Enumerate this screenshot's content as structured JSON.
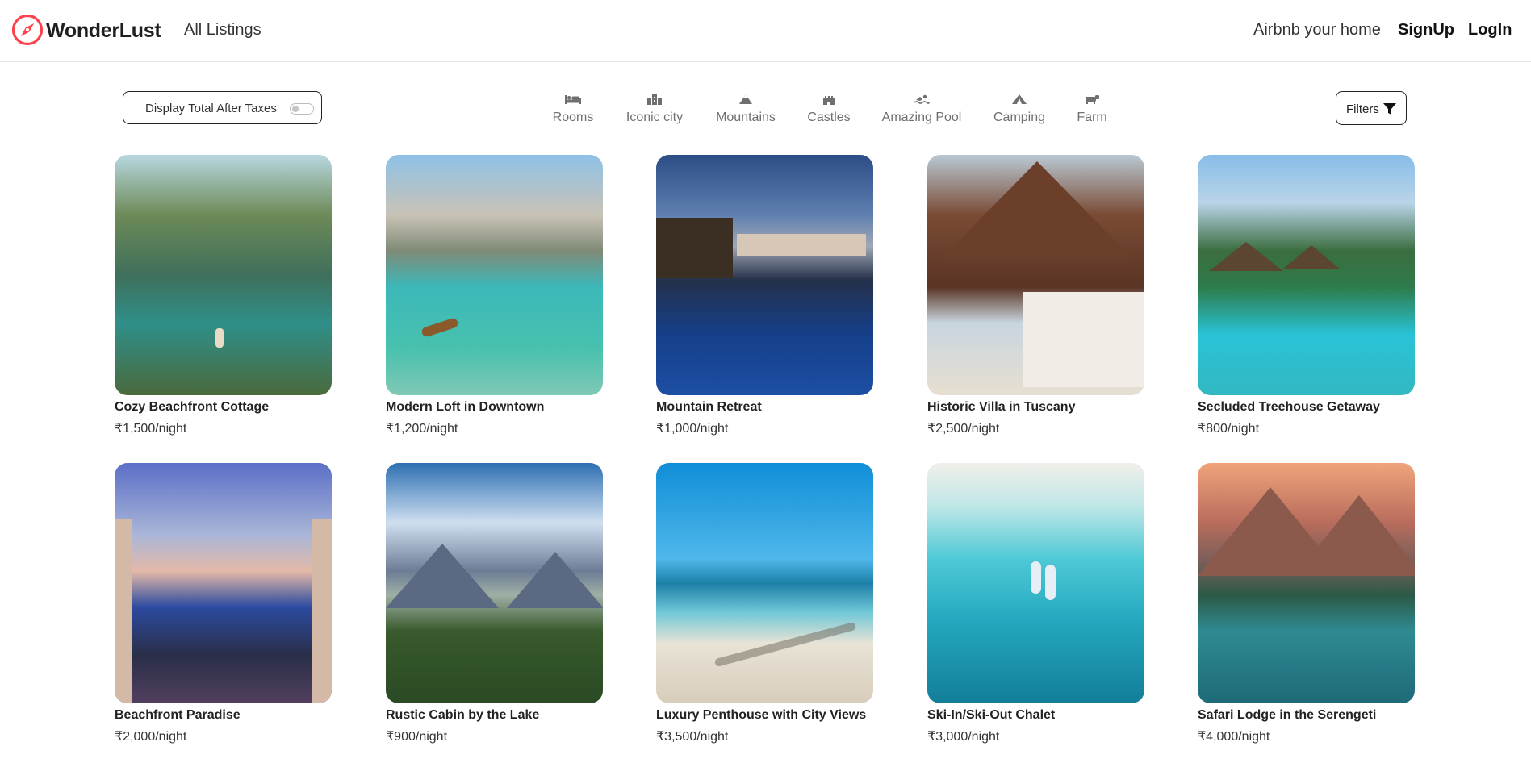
{
  "nav": {
    "brand": "WonderLust",
    "all_listings": "All Listings",
    "host_link": "Airbnb your home",
    "signup": "SignUp",
    "login": "LogIn"
  },
  "tax_toggle": {
    "label": "Display Total After Taxes",
    "enabled": false
  },
  "filters": [
    {
      "label": "Rooms",
      "icon": "bed-icon"
    },
    {
      "label": "Iconic city",
      "icon": "city-icon"
    },
    {
      "label": "Mountains",
      "icon": "mountain-icon"
    },
    {
      "label": "Castles",
      "icon": "castle-icon"
    },
    {
      "label": "Amazing Pool",
      "icon": "swimmer-icon"
    },
    {
      "label": "Camping",
      "icon": "tent-icon"
    },
    {
      "label": "Farm",
      "icon": "cow-icon"
    }
  ],
  "filters_button": {
    "label": "Filters",
    "icon": "funnel-icon"
  },
  "listings": [
    {
      "title": "Cozy Beachfront Cottage",
      "price": "₹1,500/night"
    },
    {
      "title": "Modern Loft in Downtown",
      "price": "₹1,200/night"
    },
    {
      "title": "Mountain Retreat",
      "price": "₹1,000/night"
    },
    {
      "title": "Historic Villa in Tuscany",
      "price": "₹2,500/night"
    },
    {
      "title": "Secluded Treehouse Getaway",
      "price": "₹800/night"
    },
    {
      "title": "Beachfront Paradise",
      "price": "₹2,000/night"
    },
    {
      "title": "Rustic Cabin by the Lake",
      "price": "₹900/night"
    },
    {
      "title": "Luxury Penthouse with City Views",
      "price": "₹3,500/night"
    },
    {
      "title": "Ski-In/Ski-Out Chalet",
      "price": "₹3,000/night"
    },
    {
      "title": "Safari Lodge in the Serengeti",
      "price": "₹4,000/night"
    }
  ],
  "colors": {
    "brand_accent": "#fe424d",
    "text_primary": "#222222",
    "muted": "#6f6f6f",
    "border": "#e4e4e4"
  }
}
